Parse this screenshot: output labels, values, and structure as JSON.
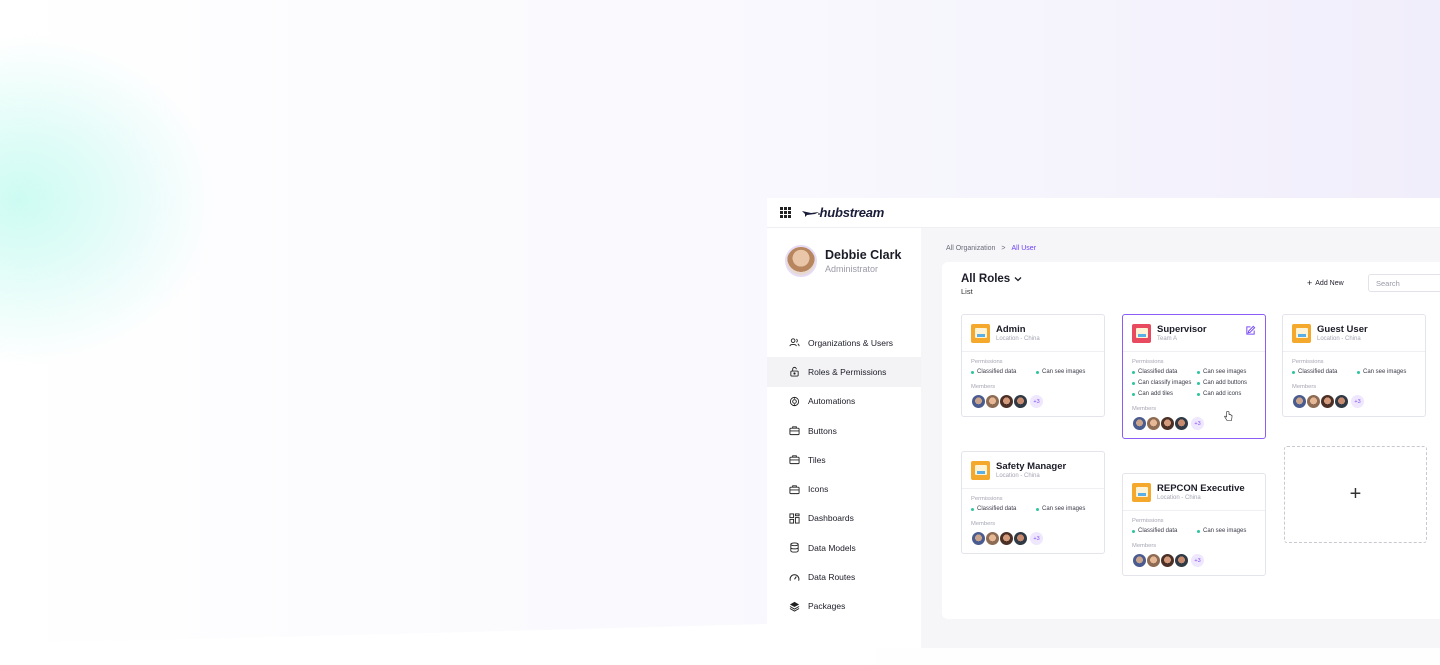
{
  "app": {
    "logo_text": "hubstream"
  },
  "profile": {
    "name": "Debbie Clark",
    "role": "Administrator"
  },
  "sidebar": {
    "items": [
      {
        "label": "Organizations & Users",
        "icon": "users-icon"
      },
      {
        "label": "Roles & Permissions",
        "icon": "lock-icon",
        "active": true
      },
      {
        "label": "Automations",
        "icon": "automation-icon"
      },
      {
        "label": "Buttons",
        "icon": "briefcase-icon"
      },
      {
        "label": "Tiles",
        "icon": "briefcase-icon"
      },
      {
        "label": "Icons",
        "icon": "briefcase-icon"
      },
      {
        "label": "Dashboards",
        "icon": "dashboard-icon"
      },
      {
        "label": "Data Models",
        "icon": "database-icon"
      },
      {
        "label": "Data Routes",
        "icon": "gauge-icon"
      },
      {
        "label": "Packages",
        "icon": "layers-icon"
      }
    ]
  },
  "breadcrumb": {
    "root": "All Organization",
    "separator": ">",
    "current": "All User"
  },
  "panel": {
    "title": "All Roles",
    "subtitle": "List",
    "add_new": "Add New",
    "search_placeholder": "Search"
  },
  "labels": {
    "permissions": "Permissions",
    "members": "Members"
  },
  "cards": [
    {
      "title": "Admin",
      "subtitle": "Location - China",
      "permissions": [
        "Classified data",
        "Can see images"
      ],
      "more": "+3"
    },
    {
      "title": "Supervisor",
      "subtitle": "Team A",
      "permissions": [
        "Classified data",
        "Can see images",
        "Can classify images",
        "Can add buttons",
        "Can add tiles",
        "Can add icons"
      ],
      "more": "+3"
    },
    {
      "title": "Guest User",
      "subtitle": "Location - China",
      "permissions": [
        "Classified data",
        "Can see images"
      ],
      "more": "+3"
    },
    {
      "title": "Safety Manager",
      "subtitle": "Location - China",
      "permissions": [
        "Classified data",
        "Can see images"
      ],
      "more": "+3"
    },
    {
      "title": "REPCON Executive",
      "subtitle": "Location - China",
      "permissions": [
        "Classified data",
        "Can see images"
      ],
      "more": "+3"
    }
  ],
  "add_card": {
    "symbol": "+"
  },
  "colors": {
    "accent": "#8b5cf6",
    "bullet": "#2ec4a0",
    "card_icon": "#f4a92c",
    "card_icon_alt": "#e84a5f"
  }
}
